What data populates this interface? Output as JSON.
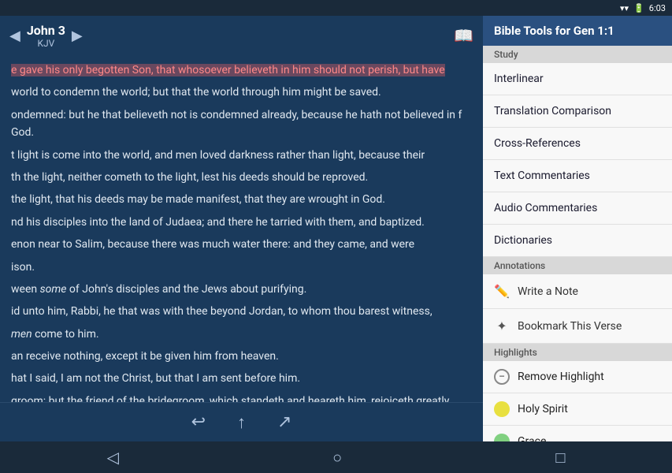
{
  "statusBar": {
    "time": "6:03",
    "icons": [
      "wifi",
      "battery"
    ]
  },
  "biblePanel": {
    "prevArrow": "◀",
    "nextArrow": "▶",
    "bookName": "John 3",
    "version": "KJV",
    "bookIcon": "📖",
    "content": [
      {
        "id": 1,
        "text": "e gave his only begotten Son, that whosoever believeth in him should not perish, but have",
        "highlighted": true
      },
      {
        "id": 2,
        "text": "world to condemn the world; but that the world through him might be saved.",
        "highlighted": false
      },
      {
        "id": 3,
        "text": "ondemned: but he that believeth not is condemned already, because he hath not believed in f God.",
        "highlighted": false
      },
      {
        "id": 4,
        "text": "t light is come into the world, and men loved darkness rather than light, because their",
        "highlighted": false
      },
      {
        "id": 5,
        "text": "th the light, neither cometh to the light, lest his deeds should be reproved.",
        "highlighted": false
      },
      {
        "id": 6,
        "text": "the light, that his deeds may be made manifest, that they are wrought in God.",
        "highlighted": false
      },
      {
        "id": 7,
        "text": "nd his disciples into the land of Judaea; and there he tarried with them, and baptized.",
        "highlighted": false
      },
      {
        "id": 8,
        "text": "enon near to Salim, because there was much water there: and they came, and were",
        "highlighted": false
      },
      {
        "id": 9,
        "text": "ison.",
        "highlighted": false
      },
      {
        "id": 10,
        "text": "ween some of John's disciples and the Jews about purifying.",
        "highlighted": false
      },
      {
        "id": 11,
        "text": "id unto him, Rabbi, he that was with thee beyond Jordan, to whom thou barest witness,",
        "highlighted": false
      },
      {
        "id": 12,
        "text": "men come to him.",
        "highlighted": false
      },
      {
        "id": 13,
        "text": "an receive nothing, except it be given him from heaven.",
        "highlighted": false
      },
      {
        "id": 14,
        "text": "hat I said, I am not the Christ, but that I am sent before him.",
        "highlighted": false
      },
      {
        "id": 15,
        "text": "groom: but the friend of the bridegroom, which standeth and heareth him, rejoiceth greatly",
        "highlighted": false
      }
    ],
    "toolbar": {
      "backBtn": "↩",
      "upBtn": "↑",
      "shareBtn": "↗"
    }
  },
  "navBar": {
    "backBtn": "◁",
    "homeBtn": "○",
    "squareBtn": "□"
  },
  "rightPanel": {
    "title": "Bible Tools for Gen 1:1",
    "studySection": {
      "label": "Study",
      "items": [
        {
          "id": "interlinear",
          "label": "Interlinear"
        },
        {
          "id": "translation-comparison",
          "label": "Translation Comparison"
        },
        {
          "id": "cross-references",
          "label": "Cross-References"
        },
        {
          "id": "text-commentaries",
          "label": "Text Commentaries"
        },
        {
          "id": "audio-commentaries",
          "label": "Audio Commentaries"
        },
        {
          "id": "dictionaries",
          "label": "Dictionaries"
        }
      ]
    },
    "annotationsSection": {
      "label": "Annotations",
      "items": [
        {
          "id": "write-a-note",
          "label": "Write a Note",
          "icon": "pencil"
        },
        {
          "id": "bookmark-this-verse",
          "label": "Bookmark This Verse",
          "icon": "star"
        }
      ]
    },
    "highlightsSection": {
      "label": "Highlights",
      "items": [
        {
          "id": "remove-highlight",
          "label": "Remove Highlight",
          "icon": "minus-circle",
          "color": null
        },
        {
          "id": "holy-spirit",
          "label": "Holy Spirit",
          "color": "#e8e040"
        },
        {
          "id": "grace",
          "label": "Grace",
          "color": "#80d080"
        }
      ]
    }
  }
}
